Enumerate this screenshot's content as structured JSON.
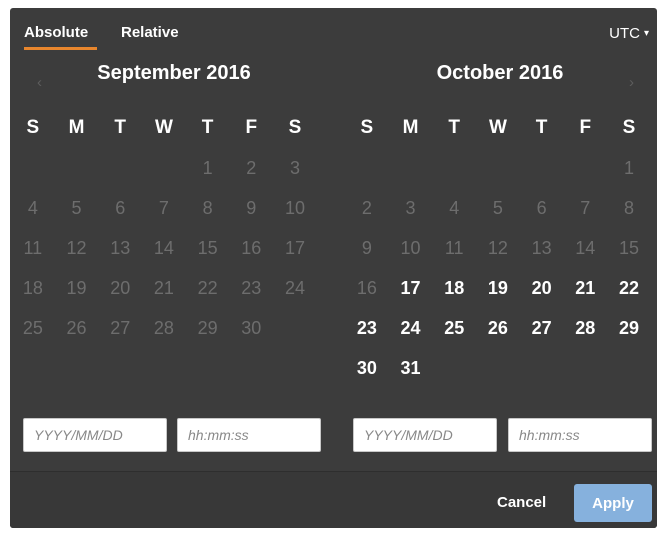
{
  "tabs": {
    "absolute": "Absolute",
    "relative": "Relative"
  },
  "timezone": {
    "label": "UTC",
    "caret": "▾"
  },
  "nav": {
    "prev": "‹",
    "next": "›"
  },
  "weekdays": [
    "S",
    "M",
    "T",
    "W",
    "T",
    "F",
    "S"
  ],
  "calendars": [
    {
      "title": "September  2016",
      "weeks": [
        [
          {
            "d": "",
            "s": "off"
          },
          {
            "d": "",
            "s": "off"
          },
          {
            "d": "",
            "s": "off"
          },
          {
            "d": "",
            "s": "off"
          },
          {
            "d": "1",
            "s": "off"
          },
          {
            "d": "2",
            "s": "off"
          },
          {
            "d": "3",
            "s": "off"
          }
        ],
        [
          {
            "d": "4",
            "s": "off"
          },
          {
            "d": "5",
            "s": "off"
          },
          {
            "d": "6",
            "s": "off"
          },
          {
            "d": "7",
            "s": "off"
          },
          {
            "d": "8",
            "s": "off"
          },
          {
            "d": "9",
            "s": "off"
          },
          {
            "d": "10",
            "s": "off"
          }
        ],
        [
          {
            "d": "11",
            "s": "off"
          },
          {
            "d": "12",
            "s": "off"
          },
          {
            "d": "13",
            "s": "off"
          },
          {
            "d": "14",
            "s": "off"
          },
          {
            "d": "15",
            "s": "off"
          },
          {
            "d": "16",
            "s": "off"
          },
          {
            "d": "17",
            "s": "off"
          }
        ],
        [
          {
            "d": "18",
            "s": "off"
          },
          {
            "d": "19",
            "s": "off"
          },
          {
            "d": "20",
            "s": "off"
          },
          {
            "d": "21",
            "s": "off"
          },
          {
            "d": "22",
            "s": "off"
          },
          {
            "d": "23",
            "s": "off"
          },
          {
            "d": "24",
            "s": "off"
          }
        ],
        [
          {
            "d": "25",
            "s": "off"
          },
          {
            "d": "26",
            "s": "off"
          },
          {
            "d": "27",
            "s": "off"
          },
          {
            "d": "28",
            "s": "off"
          },
          {
            "d": "29",
            "s": "off"
          },
          {
            "d": "30",
            "s": "off"
          },
          {
            "d": "",
            "s": "off"
          }
        ],
        [
          {
            "d": "",
            "s": "off"
          },
          {
            "d": "",
            "s": "off"
          },
          {
            "d": "",
            "s": "off"
          },
          {
            "d": "",
            "s": "off"
          },
          {
            "d": "",
            "s": "off"
          },
          {
            "d": "",
            "s": "off"
          },
          {
            "d": "",
            "s": "off"
          }
        ]
      ]
    },
    {
      "title": "October  2016",
      "weeks": [
        [
          {
            "d": "",
            "s": "off"
          },
          {
            "d": "",
            "s": "off"
          },
          {
            "d": "",
            "s": "off"
          },
          {
            "d": "",
            "s": "off"
          },
          {
            "d": "",
            "s": "off"
          },
          {
            "d": "",
            "s": "off"
          },
          {
            "d": "1",
            "s": "off"
          }
        ],
        [
          {
            "d": "2",
            "s": "off"
          },
          {
            "d": "3",
            "s": "off"
          },
          {
            "d": "4",
            "s": "off"
          },
          {
            "d": "5",
            "s": "off"
          },
          {
            "d": "6",
            "s": "off"
          },
          {
            "d": "7",
            "s": "off"
          },
          {
            "d": "8",
            "s": "off"
          }
        ],
        [
          {
            "d": "9",
            "s": "off"
          },
          {
            "d": "10",
            "s": "off"
          },
          {
            "d": "11",
            "s": "off"
          },
          {
            "d": "12",
            "s": "off"
          },
          {
            "d": "13",
            "s": "off"
          },
          {
            "d": "14",
            "s": "off"
          },
          {
            "d": "15",
            "s": "off"
          }
        ],
        [
          {
            "d": "16",
            "s": "off"
          },
          {
            "d": "17",
            "s": "on"
          },
          {
            "d": "18",
            "s": "on"
          },
          {
            "d": "19",
            "s": "on"
          },
          {
            "d": "20",
            "s": "on"
          },
          {
            "d": "21",
            "s": "on"
          },
          {
            "d": "22",
            "s": "on"
          }
        ],
        [
          {
            "d": "23",
            "s": "on"
          },
          {
            "d": "24",
            "s": "on"
          },
          {
            "d": "25",
            "s": "on"
          },
          {
            "d": "26",
            "s": "on"
          },
          {
            "d": "27",
            "s": "on"
          },
          {
            "d": "28",
            "s": "on"
          },
          {
            "d": "29",
            "s": "on"
          }
        ],
        [
          {
            "d": "30",
            "s": "on"
          },
          {
            "d": "31",
            "s": "on"
          },
          {
            "d": "",
            "s": "off"
          },
          {
            "d": "",
            "s": "off"
          },
          {
            "d": "",
            "s": "off"
          },
          {
            "d": "",
            "s": "off"
          },
          {
            "d": "",
            "s": "off"
          }
        ]
      ]
    }
  ],
  "inputs": {
    "start_date": {
      "value": "",
      "placeholder": "YYYY/MM/DD"
    },
    "start_time": {
      "value": "",
      "placeholder": "hh:mm:ss"
    },
    "end_date": {
      "value": "",
      "placeholder": "YYYY/MM/DD"
    },
    "end_time": {
      "value": "",
      "placeholder": "hh:mm:ss"
    }
  },
  "footer": {
    "cancel": "Cancel",
    "apply": "Apply"
  },
  "colors": {
    "panel": "#3c3c3c",
    "accent": "#e8862d",
    "apply": "#86b1dd",
    "disabled_day": "#6d6d6d",
    "active_day": "#ffffff"
  }
}
